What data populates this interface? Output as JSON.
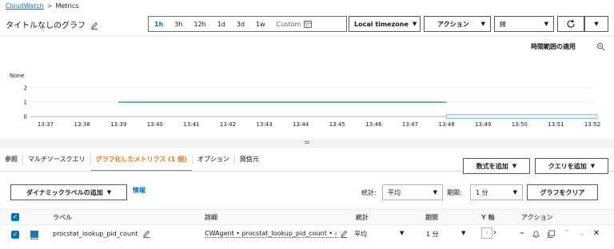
{
  "breadcrumb": {
    "root": "CloudWatch",
    "separator": ">",
    "current": "Metrics"
  },
  "graph_title": "タイトルなしのグラフ",
  "time_range": {
    "options": [
      "1h",
      "3h",
      "12h",
      "1d",
      "3d",
      "1w"
    ],
    "active": "1h",
    "custom": "Custom"
  },
  "timezone": "Local timezone",
  "actions": "アクション",
  "chart_type": "線",
  "apply_time_range": "時間範囲の適用",
  "splitter": "=",
  "chart_data": {
    "type": "line",
    "title": "",
    "ylabel": "None",
    "y_ticks": [
      "0",
      "1",
      "2"
    ],
    "ylim": [
      0,
      2
    ],
    "x": [
      "13:37",
      "13:38",
      "13:39",
      "13:40",
      "13:41",
      "13:42",
      "13:43",
      "13:44",
      "13:45",
      "13:46",
      "13:47",
      "13:48",
      "13:49",
      "13:50",
      "13:51",
      "13:52"
    ],
    "series": [
      {
        "name": "procstat_lookup_pid_count",
        "x_start": "13:39",
        "x_end": "13:48",
        "value": 1,
        "color": "#1f77b4"
      }
    ],
    "grid": true,
    "legend": "none"
  },
  "tabs": [
    {
      "label": "参照",
      "active": false
    },
    {
      "label": "マルチソースクエリ",
      "active": false
    },
    {
      "label": "グラフ化したメトリクス (1 個)",
      "active": true
    },
    {
      "label": "オプション",
      "active": false
    },
    {
      "label": "発信元",
      "active": false
    }
  ],
  "buttons": {
    "add_math": "数式を追加",
    "add_query": "クエリを追加",
    "add_dynamic_label": "ダイナミックラベルの追加",
    "info": "情報",
    "clear_graph": "グラフをクリア"
  },
  "filters": {
    "stat_label": "統計:",
    "stat_value": "平均",
    "period_label": "期間:",
    "period_value": "1 分"
  },
  "table": {
    "headers": {
      "label": "ラベル",
      "details": "詳細",
      "stat": "統計",
      "period": "期間",
      "y_axis": "Y 軸",
      "actions": "アクション"
    },
    "rows": [
      {
        "label": "procstat_lookup_pid_count",
        "details": "CWAgent • procstat_lookup_pid_count • ‹",
        "stat": "平均",
        "period": "1 分",
        "color": "#1f77b4"
      }
    ]
  },
  "colors": {
    "accent": "#0073bb",
    "active_tab": "#ec7211",
    "series": "#1f77b4"
  }
}
